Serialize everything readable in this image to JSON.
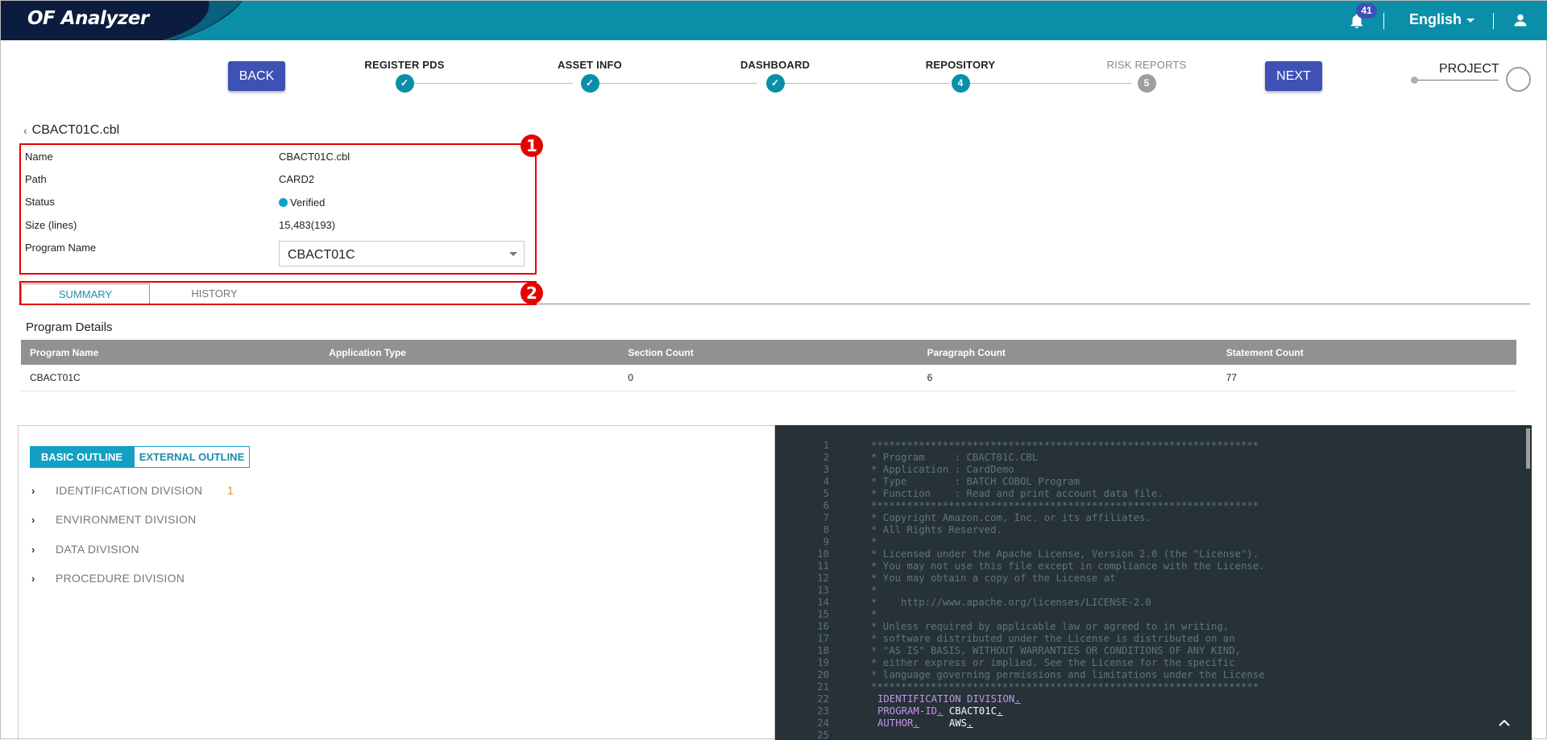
{
  "app": {
    "title": "OF Analyzer",
    "notifications_count": "41",
    "language": "English",
    "icons": {
      "notifications": "bell-icon",
      "language_dropdown": "caret-down-icon",
      "account": "user-icon"
    },
    "colors": {
      "header": "#0b8fa9",
      "header_dark": "#0c1c3f",
      "primary": "#3f51b5",
      "accent": "#14a0c4",
      "annotation": "#e60000"
    }
  },
  "stepper": {
    "back_label": "BACK",
    "next_label": "NEXT",
    "steps": [
      {
        "label": "REGISTER PDS",
        "state": "done",
        "marker": "✓"
      },
      {
        "label": "ASSET INFO",
        "state": "done",
        "marker": "✓"
      },
      {
        "label": "DASHBOARD",
        "state": "done",
        "marker": "✓"
      },
      {
        "label": "REPOSITORY",
        "state": "current",
        "marker": "4"
      },
      {
        "label": "RISK REPORTS",
        "state": "pending",
        "marker": "5"
      }
    ],
    "project_label": "PROJECT"
  },
  "file": {
    "title": "CBACT01C.cbl",
    "fields": [
      {
        "label": "Name",
        "value": "CBACT01C.cbl"
      },
      {
        "label": "Path",
        "value": "CARD2"
      },
      {
        "label": "Status",
        "value": "Verified"
      },
      {
        "label": "Size (lines)",
        "value": "15,483(193)"
      },
      {
        "label": "Program Name",
        "value": "CBACT01C"
      }
    ],
    "annotations": [
      "1",
      "2"
    ]
  },
  "tabs": [
    {
      "label": "SUMMARY",
      "active": true
    },
    {
      "label": "HISTORY",
      "active": false
    }
  ],
  "program_details": {
    "title": "Program Details",
    "columns": [
      "Program Name",
      "Application Type",
      "Section Count",
      "Paragraph Count",
      "Statement Count"
    ],
    "rows": [
      [
        "CBACT01C",
        "",
        "0",
        "6",
        "77"
      ]
    ]
  },
  "outline": {
    "modes": [
      {
        "label": "BASIC OUTLINE",
        "active": true
      },
      {
        "label": "EXTERNAL OUTLINE",
        "active": false
      }
    ],
    "items": [
      {
        "label": "IDENTIFICATION DIVISION",
        "count": "1"
      },
      {
        "label": "ENVIRONMENT DIVISION",
        "count": ""
      },
      {
        "label": "DATA DIVISION",
        "count": ""
      },
      {
        "label": "PROCEDURE DIVISION",
        "count": ""
      }
    ]
  },
  "code": {
    "lines": [
      {
        "n": "1",
        "text": "*****************************************************************"
      },
      {
        "n": "2",
        "text": "* Program     : CBACT01C.CBL"
      },
      {
        "n": "3",
        "text": "* Application : CardDemo"
      },
      {
        "n": "4",
        "text": "* Type        : BATCH COBOL Program"
      },
      {
        "n": "5",
        "text": "* Function    : Read and print account data file."
      },
      {
        "n": "6",
        "text": "*****************************************************************"
      },
      {
        "n": "7",
        "text": "* Copyright Amazon.com, Inc. or its affiliates."
      },
      {
        "n": "8",
        "text": "* All Rights Reserved."
      },
      {
        "n": "9",
        "text": "*"
      },
      {
        "n": "10",
        "text": "* Licensed under the Apache License, Version 2.0 (the \"License\")."
      },
      {
        "n": "11",
        "text": "* You may not use this file except in compliance with the License."
      },
      {
        "n": "12",
        "text": "* You may obtain a copy of the License at"
      },
      {
        "n": "13",
        "text": "*"
      },
      {
        "n": "14",
        "text": "*    http://www.apache.org/licenses/LICENSE-2.0"
      },
      {
        "n": "15",
        "text": "*"
      },
      {
        "n": "16",
        "text": "* Unless required by applicable law or agreed to in writing,"
      },
      {
        "n": "17",
        "text": "* software distributed under the License is distributed on an"
      },
      {
        "n": "18",
        "text": "* \"AS IS\" BASIS, WITHOUT WARRANTIES OR CONDITIONS OF ANY KIND,"
      },
      {
        "n": "19",
        "text": "* either express or implied. See the License for the specific"
      },
      {
        "n": "20",
        "text": "* language governing permissions and limitations under the License"
      },
      {
        "n": "21",
        "text": "*****************************************************************"
      },
      {
        "n": "22",
        "kw": "IDENTIFICATION DIVISION",
        "val": ""
      },
      {
        "n": "23",
        "kw": "PROGRAM-ID",
        "val": "CBACT01C"
      },
      {
        "n": "24",
        "kw": "AUTHOR",
        "val": "AWS"
      },
      {
        "n": "25",
        "text": ""
      }
    ]
  }
}
